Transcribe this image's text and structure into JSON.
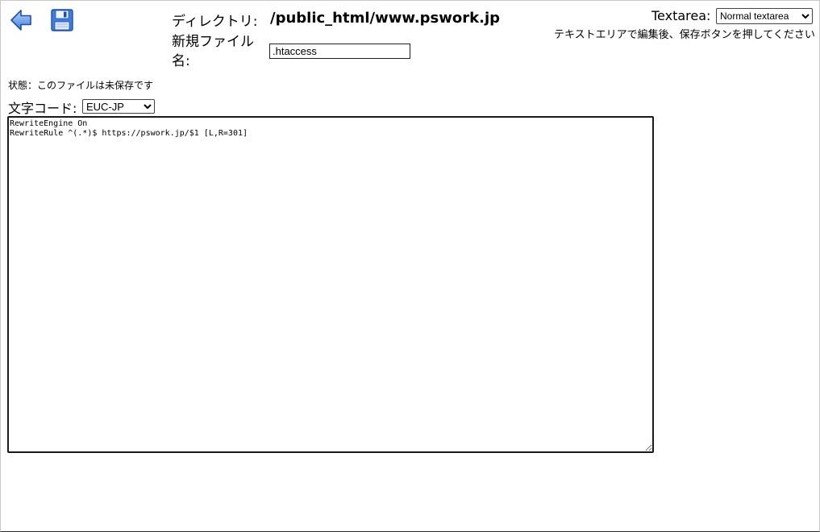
{
  "toolbar": {
    "back_icon": "back-arrow-icon",
    "save_icon": "floppy-disk-icon"
  },
  "header": {
    "directory_label": "ディレクトリ:",
    "directory_path": "/public_html/www.pswork.jp",
    "new_file_label": "新規ファイル名:",
    "file_name_value": ".htaccess"
  },
  "textarea_mode": {
    "label": "Textarea:",
    "selected": "Normal textarea",
    "hint": "テキストエリアで編集後、保存ボタンを押してください"
  },
  "status": {
    "text": "状態：このファイルは未保存です"
  },
  "charset": {
    "label": "文字コード:",
    "selected": "EUC-JP"
  },
  "editor": {
    "content": "RewriteEngine On\nRewriteRule ^(.*)$ https://pswork.jp/$1 [L,R=301]"
  },
  "colors": {
    "icon_blue": "#1f5fc4",
    "icon_light_blue": "#8fb8ef"
  }
}
